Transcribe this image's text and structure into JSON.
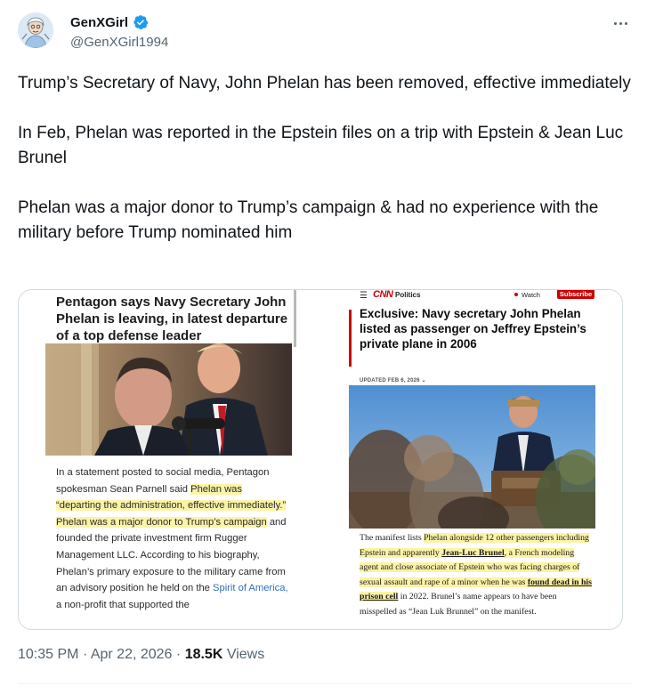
{
  "author": {
    "display_name": "GenXGirl",
    "handle": "@GenXGirl1994",
    "avatar_icon": "avatar-cartoon",
    "verified_icon": "verified-badge-icon",
    "verified_color": "#1d9bf0"
  },
  "tweet": {
    "paragraphs": [
      "Trump’s Secretary of Navy, John Phelan has been removed, effective immediately",
      "In Feb, Phelan was reported in the Epstein files on a trip with Epstein & Jean Luc Brunel",
      "Phelan was a major donor to Trump’s campaign & had no experience with the military before Trump nominated him"
    ]
  },
  "media": {
    "left_article": {
      "headline": "Pentagon says Navy Secretary John Phelan is leaving, in latest departure of a top defense leader",
      "body": [
        {
          "text": "In a statement posted to social media, Pentagon spokesman Sean Parnell said ",
          "style": "plain"
        },
        {
          "text": "Phelan was “departing the administration, effective immediately.”",
          "style": "highlight"
        },
        {
          "text": " ",
          "style": "plain"
        },
        {
          "text": "Phelan was a major donor to Trump’s campaign",
          "style": "highlight"
        },
        {
          "text": " and founded the private investment firm Rugger Management LLC. According to his biography, Phelan’s primary exposure to the military came from an advisory position he held on the ",
          "style": "plain"
        },
        {
          "text": "Spirit of America,",
          "style": "link"
        },
        {
          "text": " a non-profit that supported the",
          "style": "plain"
        }
      ]
    },
    "right_article": {
      "nav": {
        "menu_icon": "hamburger-menu-icon",
        "logo": "CNN",
        "section": "Politics",
        "watch": "Watch",
        "subscribe": "Subscribe"
      },
      "headline": "Exclusive: Navy secretary John Phelan listed as passenger on Jeffrey Epstein’s private plane in 2006",
      "date": "UPDATED FEB 6, 2026",
      "body": [
        {
          "text": "The manifest lists ",
          "style": "plain"
        },
        {
          "text": "Phelan alongside 12 other passengers including Epstein and apparently ",
          "style": "highlight"
        },
        {
          "text": "Jean-Luc Brunel",
          "style": "highlight-underline"
        },
        {
          "text": ", a French modeling agent and close associate of Epstein who was facing charges of sexual assault and rape of a minor when he was ",
          "style": "highlight"
        },
        {
          "text": "found dead in his prison cell",
          "style": "highlight-underline"
        },
        {
          "text": " in 2022. Brunel’s name appears to have been misspelled as “Jean Luk Brunnel” on the manifest.",
          "style": "plain"
        }
      ]
    }
  },
  "meta": {
    "time": "10:35 PM",
    "separator": "·",
    "date": "Apr 22, 2026",
    "views_count": "18.5K",
    "views_label": "Views"
  }
}
